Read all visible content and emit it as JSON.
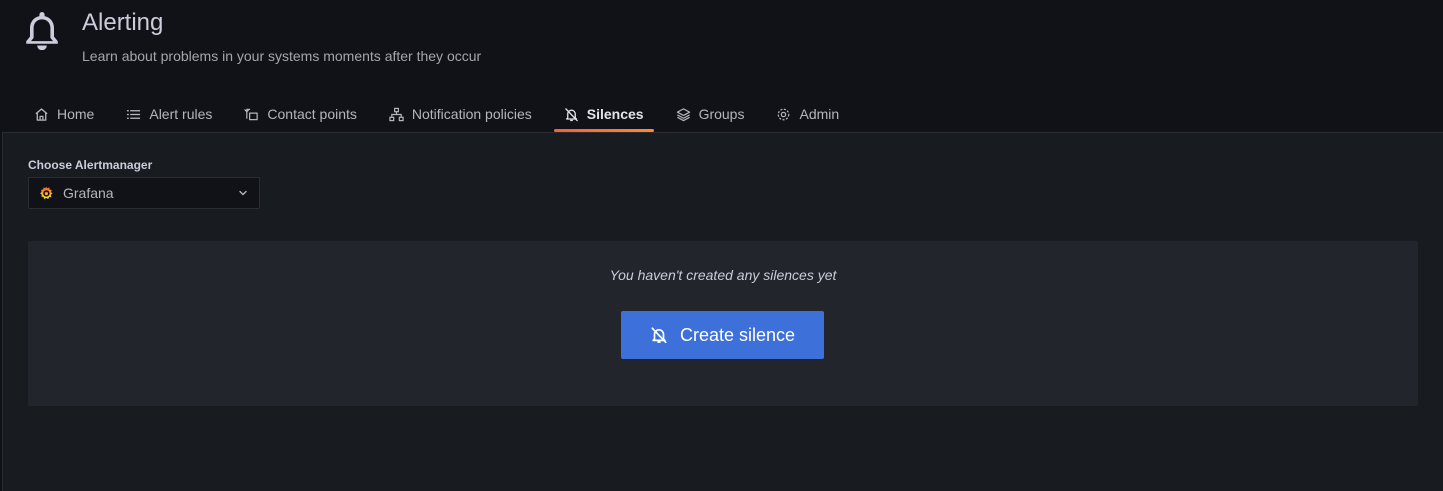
{
  "header": {
    "icon": "bell-icon",
    "title": "Alerting",
    "subtitle": "Learn about problems in your systems moments after they occur"
  },
  "tabs": [
    {
      "label": "Home",
      "icon": "home-icon",
      "active": false
    },
    {
      "label": "Alert rules",
      "icon": "list-icon",
      "active": false
    },
    {
      "label": "Contact points",
      "icon": "comment-alt-share-icon",
      "active": false
    },
    {
      "label": "Notification policies",
      "icon": "sitemap-icon",
      "active": false
    },
    {
      "label": "Silences",
      "icon": "bell-slash-icon",
      "active": true
    },
    {
      "label": "Groups",
      "icon": "layer-group-icon",
      "active": false
    },
    {
      "label": "Admin",
      "icon": "cog-icon",
      "active": false
    }
  ],
  "alertmanager": {
    "label": "Choose Alertmanager",
    "selected": "Grafana",
    "logo": "grafana-logo-icon"
  },
  "empty_state": {
    "message": "You haven't created any silences yet",
    "button_label": "Create silence",
    "button_icon": "bell-slash-icon"
  },
  "colors": {
    "background": "#111217",
    "panel": "#181b1f",
    "empty_box": "#22252b",
    "primary_button": "#3d71d9",
    "active_tab_underline": "#f55f3e"
  }
}
